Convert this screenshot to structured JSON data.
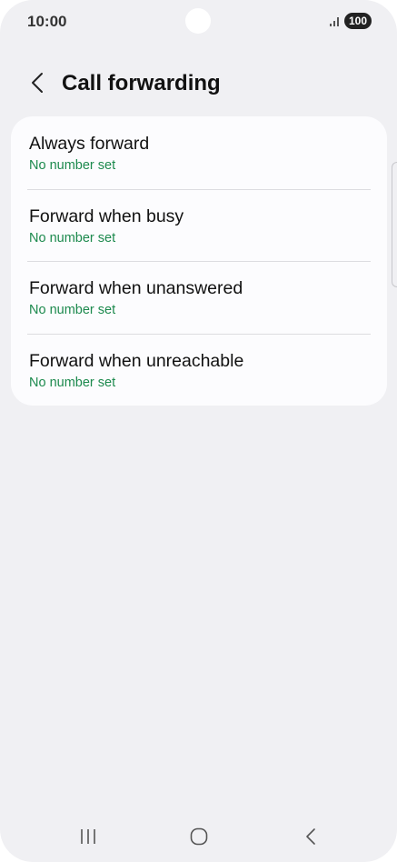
{
  "status_bar": {
    "time": "10:00",
    "battery": "100",
    "icons": [
      "signal-icon",
      "battery-icon"
    ]
  },
  "header": {
    "title": "Call forwarding",
    "back_icon": "chevron-left-icon"
  },
  "items": [
    {
      "title": "Always forward",
      "subtitle": "No number set"
    },
    {
      "title": "Forward when busy",
      "subtitle": "No number set"
    },
    {
      "title": "Forward when unanswered",
      "subtitle": "No number set"
    },
    {
      "title": "Forward when unreachable",
      "subtitle": "No number set"
    }
  ],
  "nav_bar": {
    "icons": [
      "recent-apps-icon",
      "home-icon",
      "back-icon"
    ]
  },
  "colors": {
    "background": "#f0f0f3",
    "card": "#fcfcfe",
    "subtitle": "#1d8a4e",
    "divider": "#dcdce0"
  }
}
